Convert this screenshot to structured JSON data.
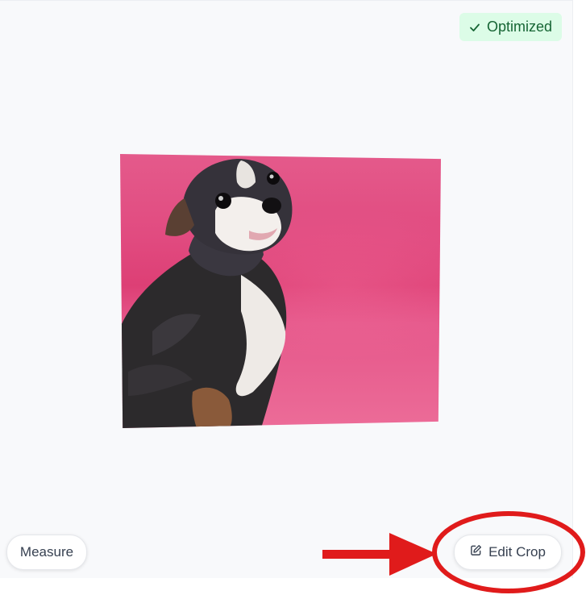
{
  "status_badge": {
    "label": "Optimized",
    "icon": "check-icon",
    "background": "#dcfce7",
    "color": "#166534"
  },
  "image": {
    "subject": "chihuahua-photo"
  },
  "toolbar": {
    "measure_label": "Measure",
    "edit_crop_label": "Edit Crop",
    "edit_crop_icon": "edit-icon"
  },
  "annotation": {
    "color": "#e01b1b",
    "marks": [
      "arrow",
      "circle"
    ]
  }
}
